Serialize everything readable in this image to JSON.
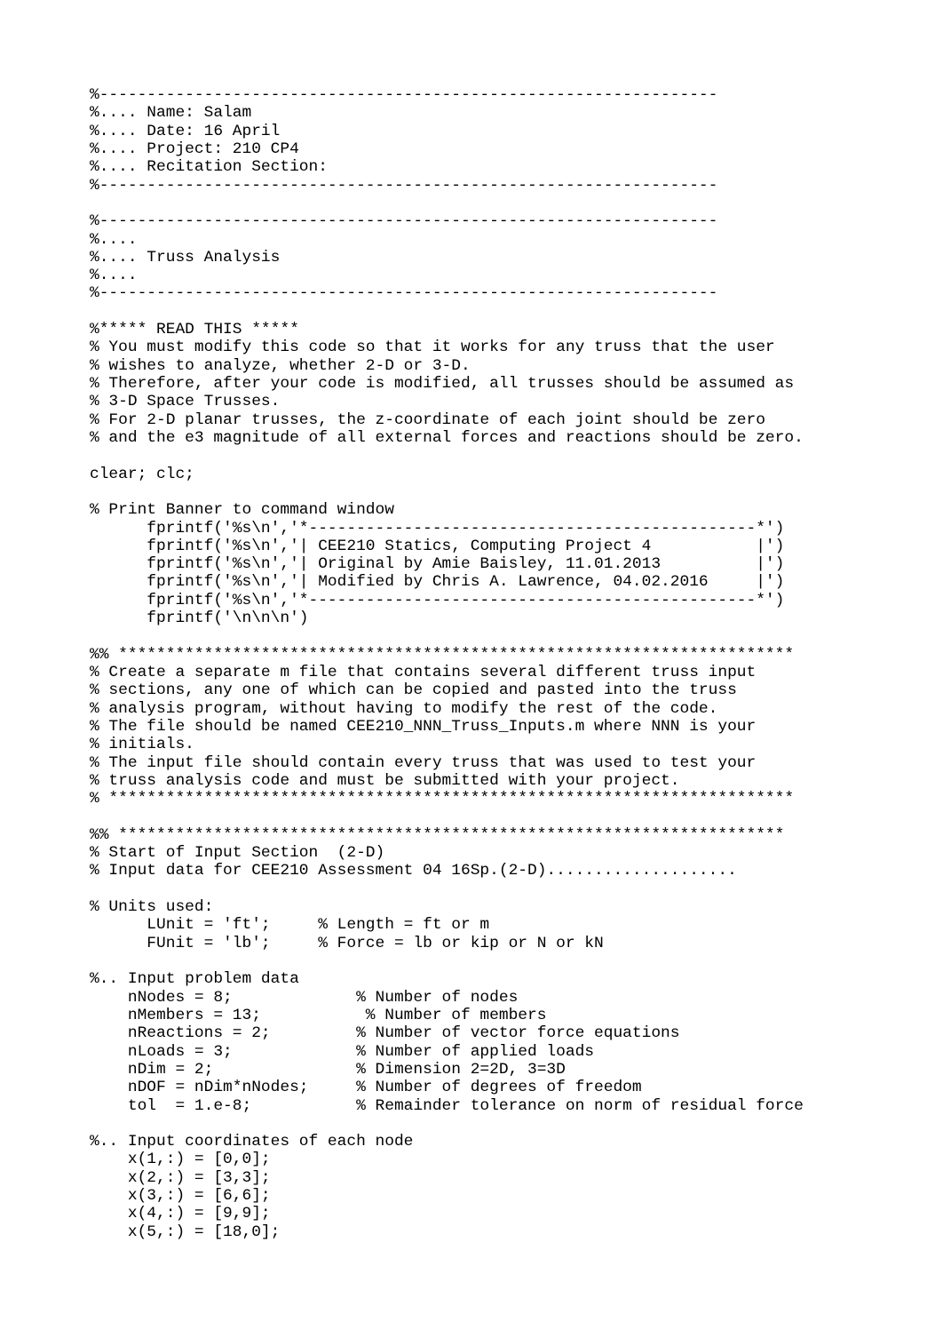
{
  "document": {
    "type": "matlab-source",
    "header": {
      "rule": "%-----------------------------------------------------------------",
      "name_line": "%.... Name: Salam",
      "date_line": "%.... Date: 16 April",
      "project_line": "%.... Project: 210 CP4",
      "recitation_line": "%.... Recitation Section:"
    },
    "title_block": {
      "rule": "%-----------------------------------------------------------------",
      "spacer": "%....",
      "title_line": "%.... Truss Analysis"
    },
    "read_this": {
      "heading": "%***** READ THIS *****",
      "lines": [
        "% You must modify this code so that it works for any truss that the user",
        "% wishes to analyze, whether 2-D or 3-D.",
        "% Therefore, after your code is modified, all trusses should be assumed as",
        "% 3-D Space Trusses.",
        "% For 2-D planar trusses, the z-coordinate of each joint should be zero",
        "% and the e3 magnitude of all external forces and reactions should be zero."
      ]
    },
    "clear_line": "clear; clc;",
    "banner": {
      "comment": "% Print Banner to command window",
      "lines": [
        "      fprintf('%s\\n','*-----------------------------------------------*')",
        "      fprintf('%s\\n','| CEE210 Statics, Computing Project 4           |')",
        "      fprintf('%s\\n','| Original by Amie Baisley, 11.01.2013          |')",
        "      fprintf('%s\\n','| Modified by Chris A. Lawrence, 04.02.2016     |')",
        "      fprintf('%s\\n','*-----------------------------------------------*')",
        "      fprintf('\\n\\n\\n')"
      ]
    },
    "instructions": {
      "open_rule": "%% ***********************************************************************",
      "lines": [
        "% Create a separate m file that contains several different truss input",
        "% sections, any one of which can be copied and pasted into the truss",
        "% analysis program, without having to modify the rest of the code.",
        "% The file should be named CEE210_NNN_Truss_Inputs.m where NNN is your",
        "% initials.",
        "% The input file should contain every truss that was used to test your",
        "% truss analysis code and must be submitted with your project."
      ],
      "close_rule": "% ************************************************************************"
    },
    "input_section": {
      "open_rule": "%% **********************************************************************",
      "start_line": "% Start of Input Section  (2-D)",
      "data_line": "% Input data for CEE210 Assessment 04 16Sp.(2-D)...................."
    },
    "units": {
      "comment": "% Units used:",
      "lines": [
        "      LUnit = 'ft';     % Length = ft or m",
        "      FUnit = 'lb';     % Force = lb or kip or N or kN"
      ]
    },
    "problem_data": {
      "comment": "%.. Input problem data",
      "lines": [
        "    nNodes = 8;             % Number of nodes",
        "    nMembers = 13;           % Number of members",
        "    nReactions = 2;         % Number of vector force equations",
        "    nLoads = 3;             % Number of applied loads",
        "    nDim = 2;               % Dimension 2=2D, 3=3D",
        "    nDOF = nDim*nNodes;     % Number of degrees of freedom",
        "    tol  = 1.e-8;           % Remainder tolerance on norm of residual force"
      ]
    },
    "coordinates": {
      "comment": "%.. Input coordinates of each node",
      "lines": [
        "    x(1,:) = [0,0];",
        "    x(2,:) = [3,3];",
        "    x(3,:) = [6,6];",
        "    x(4,:) = [9,9];",
        "    x(5,:) = [18,0];"
      ]
    }
  }
}
